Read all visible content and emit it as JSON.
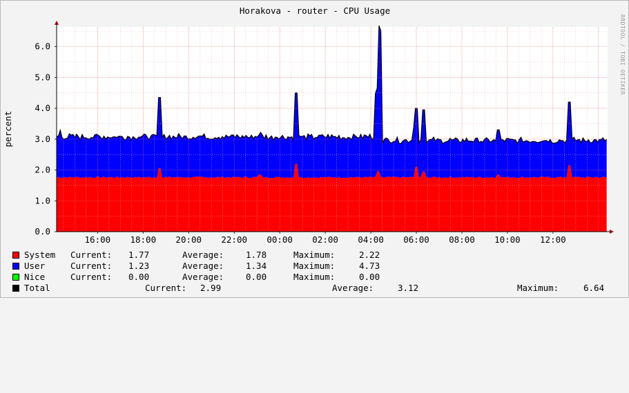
{
  "window": {
    "side_text": "RRDTOOL / TOBI OETIKER"
  },
  "chart_data": {
    "type": "area",
    "title": "Horakova - router - CPU Usage",
    "xlabel": "",
    "ylabel": "percent",
    "ylim": [
      0,
      6.64
    ],
    "yticks": [
      "0.0",
      "1.0",
      "2.0",
      "3.0",
      "4.0",
      "5.0",
      "6.0"
    ],
    "xticks": [
      "16:00",
      "18:00",
      "20:00",
      "22:00",
      "00:00",
      "02:00",
      "04:00",
      "06:00",
      "08:00",
      "10:00",
      "12:00"
    ],
    "x_range_hours": [
      14.2,
      38.4
    ],
    "grid": true,
    "stacked": true,
    "series": [
      {
        "name": "System",
        "color": "#ff0000",
        "base": 1.76,
        "spikes": [
          [
            18.7,
            2.05
          ],
          [
            23.1,
            1.85
          ],
          [
            0.7,
            2.2
          ],
          [
            4.3,
            1.95
          ],
          [
            6.0,
            2.1
          ],
          [
            6.3,
            1.95
          ],
          [
            9.6,
            1.85
          ],
          [
            12.7,
            2.15
          ]
        ]
      },
      {
        "name": "User",
        "color": "#0000ff",
        "base": 1.32,
        "spikes": [
          [
            14.35,
            1.55
          ],
          [
            18.7,
            2.3
          ],
          [
            0.7,
            2.3
          ],
          [
            4.25,
            2.7
          ],
          [
            4.4,
            4.73
          ],
          [
            5.9,
            1.6
          ],
          [
            6.0,
            1.9
          ],
          [
            6.3,
            2.0
          ],
          [
            9.6,
            1.45
          ],
          [
            12.7,
            2.05
          ]
        ]
      },
      {
        "name": "Nice",
        "color": "#00ff00",
        "base": 0.0,
        "spikes": []
      }
    ],
    "legend": {
      "labels": {
        "current": "Current:",
        "average": "Average:",
        "maximum": "Maximum:"
      },
      "rows": [
        {
          "name": "System",
          "color": "#ff0000",
          "current": "1.77",
          "average": "1.78",
          "maximum": "2.22"
        },
        {
          "name": "User",
          "color": "#0000ff",
          "current": "1.23",
          "average": "1.34",
          "maximum": "4.73"
        },
        {
          "name": "Nice",
          "color": "#00ff00",
          "current": "0.00",
          "average": "0.00",
          "maximum": "0.00"
        }
      ],
      "total": {
        "name": "Total",
        "color": "#000000",
        "current": "2.99",
        "average": "3.12",
        "maximum": "6.64"
      }
    }
  }
}
